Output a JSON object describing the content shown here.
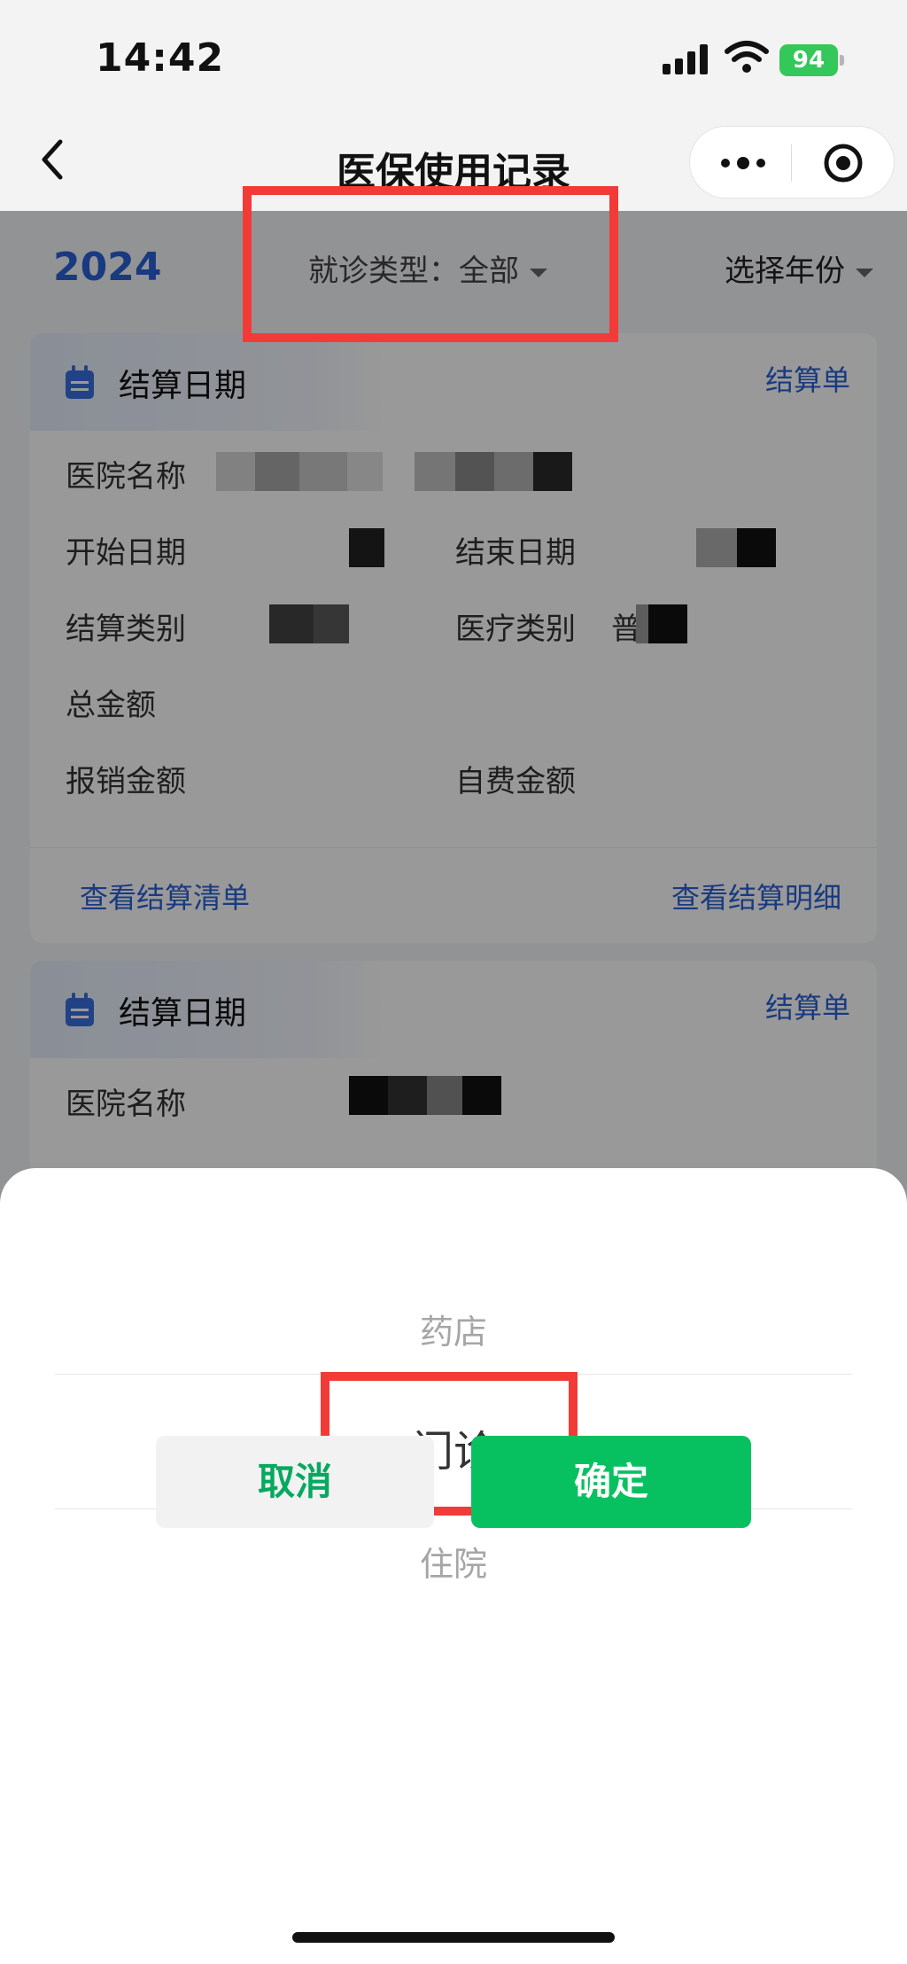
{
  "status_bar": {
    "time": "14:42",
    "battery": "94"
  },
  "nav": {
    "title": "医保使用记录"
  },
  "filter": {
    "year": "2024",
    "type_label": "就诊类型：全部",
    "select_year": "选择年份"
  },
  "cards": [
    {
      "title": "结算日期",
      "link": "结算单",
      "fields": {
        "hospital": "医院名称",
        "start": "开始日期",
        "end": "结束日期",
        "settle_type": "结算类别",
        "medical_type": "医疗类别",
        "medical_type_partial": "普",
        "total": "总金额",
        "reimburse": "报销金额",
        "self_pay": "自费金额"
      },
      "footer": {
        "list": "查看结算清单",
        "detail": "查看结算明细"
      }
    },
    {
      "title": "结算日期",
      "link": "结算单",
      "fields": {
        "hospital": "医院名称"
      }
    }
  ],
  "picker": {
    "options": [
      "药店",
      "门诊",
      "住院"
    ],
    "selected": "门诊",
    "cancel": "取消",
    "confirm": "确定"
  },
  "colors": {
    "accent": "#2b62d6",
    "confirm": "#07c160",
    "highlight": "#f23b36"
  }
}
